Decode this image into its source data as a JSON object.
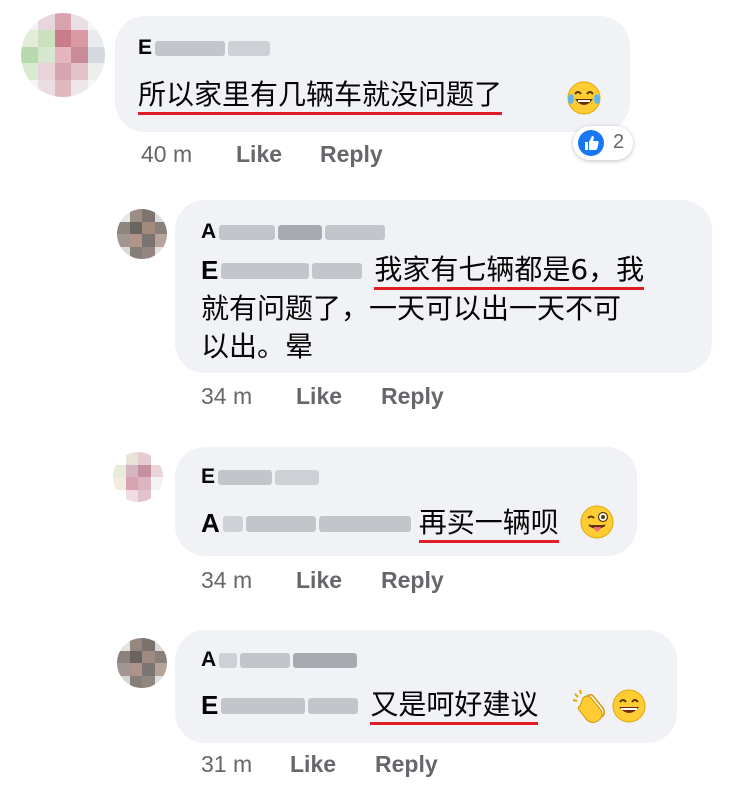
{
  "comments": [
    {
      "author_initial": "E",
      "text": "所以家里有几辆车就没问题了",
      "time": "40 m",
      "like_label": "Like",
      "reply_label": "Reply",
      "reaction": {
        "icon": "thumbs-up-icon",
        "count": "2"
      },
      "emoji": [
        "laughing-tears-emoji"
      ]
    },
    {
      "author_initial": "A",
      "mention_initial": "E",
      "text_line1": "我家有七辆都是6，我",
      "text_line2": "就有问题了，一天可以出一天不可",
      "text_line3": "以出。晕",
      "time": "34 m",
      "like_label": "Like",
      "reply_label": "Reply"
    },
    {
      "author_initial": "E",
      "mention_initial": "A",
      "text": "再买一辆呗",
      "time": "34 m",
      "like_label": "Like",
      "reply_label": "Reply",
      "emoji": [
        "winking-tongue-emoji"
      ]
    },
    {
      "author_initial": "A",
      "mention_initial": "E",
      "text": "又是呵好建议",
      "time": "31 m",
      "like_label": "Like",
      "reply_label": "Reply",
      "emoji": [
        "clapping-hands-emoji",
        "grinning-emoji"
      ]
    }
  ],
  "colors": {
    "bubble": "#f0f2f5",
    "meta_text": "#65676b",
    "underline": "#e01e25",
    "like_blue": "#1877f2"
  }
}
